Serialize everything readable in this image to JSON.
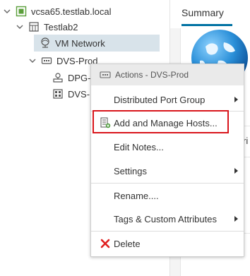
{
  "tree": {
    "vcenter_label": "vcsa65.testlab.local",
    "datacenter_label": "Testlab2",
    "network_label": "VM Network",
    "dvs_label": "DVS-Prod",
    "dpg_label": "DPG-",
    "uplink_label": "DVS-"
  },
  "right_panel": {
    "tab_summary": "Summary",
    "partial_text": "ri"
  },
  "context_menu": {
    "header": "Actions - DVS-Prod",
    "items": {
      "distributed_port_group": "Distributed Port Group",
      "add_manage_hosts": "Add and Manage Hosts...",
      "edit_notes": "Edit Notes...",
      "settings": "Settings",
      "rename": "Rename....",
      "tags_custom_attributes": "Tags & Custom Attributes",
      "delete": "Delete"
    }
  },
  "colors": {
    "accent": "#0072a3",
    "highlight": "#d9151b",
    "selected_row": "#d8e3ea",
    "delete_icon": "#e02020"
  },
  "icons": {
    "vcenter": "vcenter-icon",
    "datacenter": "datacenter-icon",
    "network": "network-icon",
    "dvs": "dvs-icon",
    "dpg": "port-group-icon",
    "uplink": "uplink-icon",
    "delete": "delete-icon"
  }
}
